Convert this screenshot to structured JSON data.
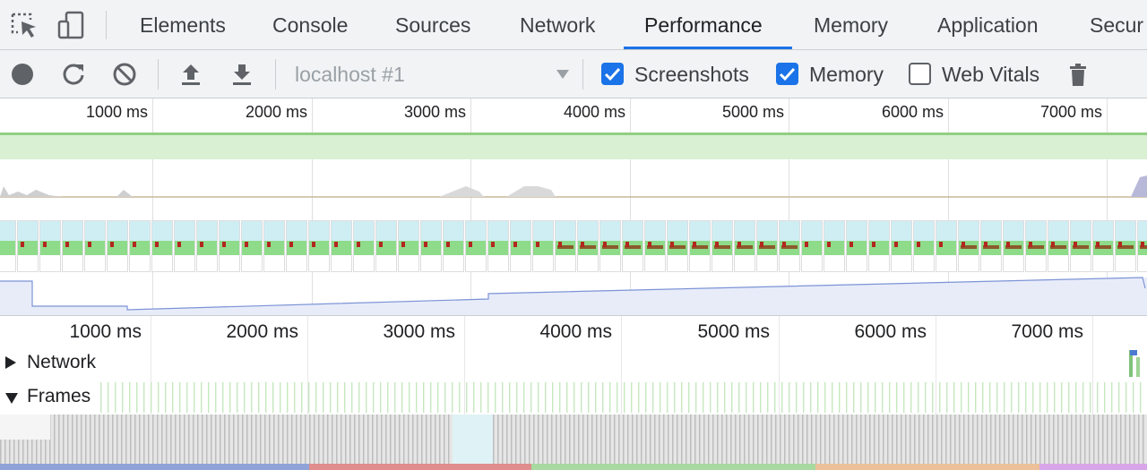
{
  "devtools": {
    "tabs": [
      {
        "label": "Elements"
      },
      {
        "label": "Console"
      },
      {
        "label": "Sources"
      },
      {
        "label": "Network"
      },
      {
        "label": "Performance"
      },
      {
        "label": "Memory"
      },
      {
        "label": "Application"
      },
      {
        "label": "Secur"
      }
    ],
    "active_tab": "Performance",
    "accent_color": "#1a73e8"
  },
  "toolbar": {
    "profile_select": "localhost #1",
    "checkboxes": [
      {
        "label": "Screenshots",
        "checked": true
      },
      {
        "label": "Memory",
        "checked": true
      },
      {
        "label": "Web Vitals",
        "checked": false
      }
    ]
  },
  "overview": {
    "ticks": [
      "1000 ms",
      "2000 ms",
      "3000 ms",
      "4000 ms",
      "5000 ms",
      "6000 ms",
      "7000 ms"
    ],
    "fps_color": "#d9f0d3",
    "memory_color": "#e8ecf9"
  },
  "details": {
    "ticks": [
      "1000 ms",
      "2000 ms",
      "3000 ms",
      "4000 ms",
      "5000 ms",
      "6000 ms",
      "7000 ms"
    ],
    "tracks": [
      {
        "label": "Network",
        "expanded": false
      },
      {
        "label": "Frames",
        "expanded": true
      }
    ]
  },
  "summary_bar_colors": [
    "#8fa3d8",
    "#e08d8d",
    "#a7d9a0",
    "#ecc199",
    "#d8a6e8"
  ]
}
